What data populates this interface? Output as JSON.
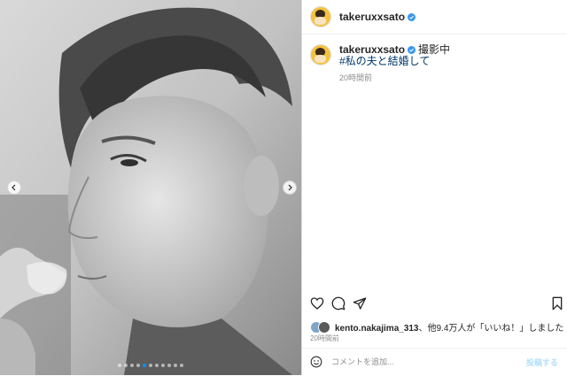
{
  "post": {
    "username": "takeruxxsato",
    "caption_username": "takeruxxsato",
    "caption_text": "撮影中",
    "hashtag": "#私の夫と結婚して",
    "caption_time": "20時間前",
    "likes_user": "kento.nakajima_313",
    "likes_rest": "、他9.4万人が「いいね！」しました",
    "post_time": "20時間前",
    "comment_placeholder": "コメントを追加...",
    "post_button": "投稿する"
  },
  "media": {
    "image_description_icon": "black-and-white-portrait-photo",
    "carousel_total": 11,
    "carousel_active": 4
  },
  "colors": {
    "accent": "#0095f6",
    "verified": "#3897f0",
    "link": "#00376b",
    "muted": "#8e8e8e",
    "post_button_disabled": "#b2dffc"
  },
  "icons": {
    "like": "heart-icon",
    "comment": "comment-icon",
    "share": "paper-plane-icon",
    "save": "bookmark-icon",
    "emoji": "smiley-icon",
    "prev": "chevron-left-icon",
    "next": "chevron-right-icon"
  }
}
